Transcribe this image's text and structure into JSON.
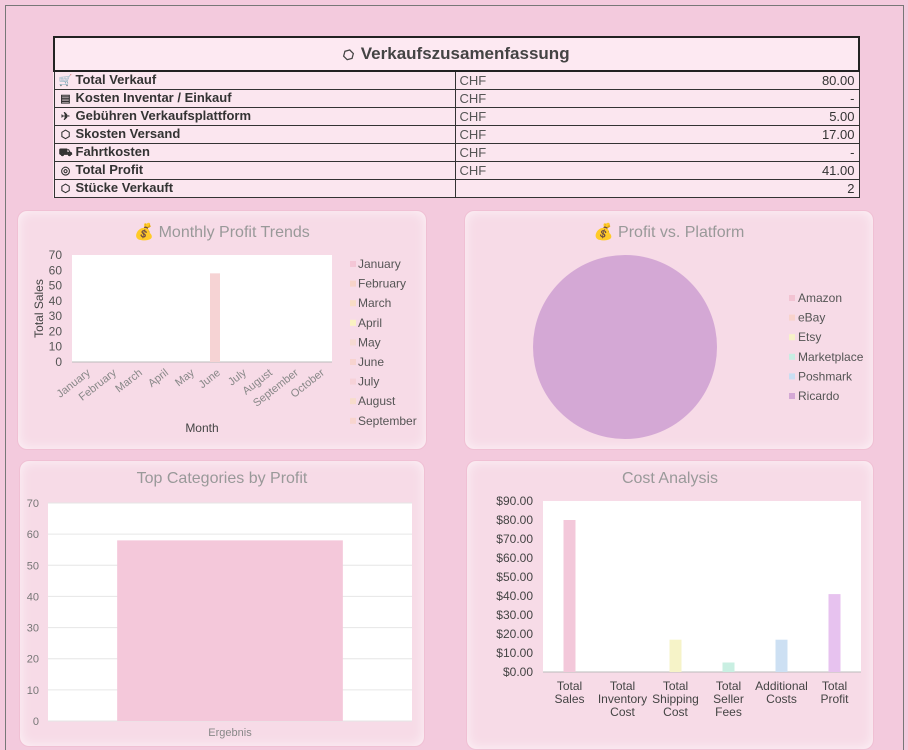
{
  "summary": {
    "title": "Verkaufszusamenfassung",
    "title_icon": "tag-icon",
    "rows": [
      {
        "label": "Total Verkauf",
        "icon": "cart-icon",
        "currency": "CHF",
        "value": "80.00"
      },
      {
        "label": "Kosten Inventar / Einkauf",
        "icon": "receipt-icon",
        "currency": "CHF",
        "value": "-"
      },
      {
        "label": "Gebühren Verkaufsplattform",
        "icon": "money-wings-icon",
        "currency": "CHF",
        "value": "5.00"
      },
      {
        "label": "Skosten Versand",
        "icon": "package-icon",
        "currency": "CHF",
        "value": "17.00"
      },
      {
        "label": "Fahrtkosten",
        "icon": "car-icon",
        "currency": "CHF",
        "value": "-"
      },
      {
        "label": "Total Profit",
        "icon": "money-bag-icon",
        "currency": "CHF",
        "value": "41.00"
      },
      {
        "label": "Stücke Verkauft",
        "icon": "package-icon",
        "currency": "",
        "value": "2"
      }
    ]
  },
  "chart_data": [
    {
      "type": "bar",
      "title": "💰 Monthly Profit Trends",
      "xlabel": "Month",
      "ylabel": "Total Sales",
      "ylim": [
        0,
        70
      ],
      "yticks": [
        0,
        10,
        20,
        30,
        40,
        50,
        60,
        70
      ],
      "categories": [
        "January",
        "February",
        "March",
        "April",
        "May",
        "June",
        "July",
        "August",
        "September",
        "October"
      ],
      "values": [
        0,
        0,
        0,
        0,
        0,
        58,
        0,
        0,
        0,
        0
      ],
      "legend_position": "right",
      "legend": [
        "January",
        "February",
        "March",
        "April",
        "May",
        "June",
        "July",
        "August",
        "September"
      ],
      "legend_colors": [
        "#f4c6d6",
        "#f7d3c9",
        "#f8dcc6",
        "#faf2c2",
        "#f6d9d2",
        "#f7d3cf",
        "#f6d2d8",
        "#f7dccb",
        "#f8d5cf"
      ],
      "bar_color": "#f6d3d4"
    },
    {
      "type": "pie",
      "title": "💰 Profit vs. Platform",
      "categories": [
        "Amazon",
        "eBay",
        "Etsy",
        "Marketplace",
        "Poshmark",
        "Ricardo"
      ],
      "values": [
        0,
        0,
        0,
        0,
        0,
        100
      ],
      "colors": [
        "#f2c3d2",
        "#f8d3cc",
        "#f7f2c8",
        "#c8eee3",
        "#c9def2",
        "#d4a8d5"
      ],
      "legend_position": "right"
    },
    {
      "type": "bar",
      "title": "Top  Categories by Profit",
      "ylim": [
        0,
        70
      ],
      "yticks": [
        0,
        10,
        20,
        30,
        40,
        50,
        60,
        70
      ],
      "categories": [
        "Ergebnis"
      ],
      "values": [
        58
      ],
      "bar_color": "#f4c8da",
      "grid": true
    },
    {
      "type": "bar",
      "title": "Cost Analysis",
      "ylim": [
        0,
        90
      ],
      "yticks": [
        "$0.00",
        "$10.00",
        "$20.00",
        "$30.00",
        "$40.00",
        "$50.00",
        "$60.00",
        "$70.00",
        "$80.00",
        "$90.00"
      ],
      "categories": [
        [
          "Total",
          "Sales"
        ],
        [
          "Total",
          "Inventory",
          "Cost"
        ],
        [
          "Total",
          "Shipping",
          "Cost"
        ],
        [
          "Total",
          "Seller",
          "Fees"
        ],
        [
          "Additional",
          "Costs"
        ],
        [
          "Total",
          "Profit"
        ]
      ],
      "values": [
        80,
        0,
        17,
        5,
        17,
        41
      ],
      "colors": [
        "#f3c8da",
        "#f3c8da",
        "#f6f3c8",
        "#c9efe2",
        "#cde0f3",
        "#e7c2ef"
      ]
    }
  ]
}
